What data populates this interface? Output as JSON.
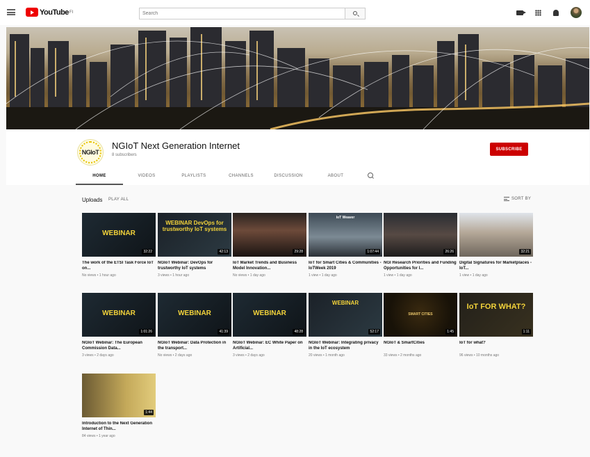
{
  "header": {
    "logo_text": "YouTube",
    "logo_region": "FI",
    "search_placeholder": "Search"
  },
  "channel": {
    "name": "NGIoT Next Generation Internet",
    "avatar_text": "NGIoT",
    "subscribers": "8 subscribers",
    "subscribe_label": "SUBSCRIBE"
  },
  "tabs": [
    "HOME",
    "VIDEOS",
    "PLAYLISTS",
    "CHANNELS",
    "DISCUSSION",
    "ABOUT"
  ],
  "section": {
    "title": "Uploads",
    "play_all": "PLAY ALL",
    "sort_by": "SORT BY"
  },
  "videos": [
    {
      "title": "The work of the ETSI Task Force IoT on...",
      "meta": "No views • 1 hour ago",
      "duration": "32:22",
      "thumb_text": "WEBINAR",
      "theme": "webinar"
    },
    {
      "title": "NGIoT Webinar: DevOps for trustworthy IoT systems",
      "meta": "3 views • 1 hour ago",
      "duration": "42:13",
      "thumb_text": "WEBINAR DevOps for trustworthy IoT systems",
      "theme": "webinar2"
    },
    {
      "title": "IoT Market Trends and Business Model Innovation...",
      "meta": "No views • 1 day ago",
      "duration": "29:28",
      "thumb_text": "",
      "theme": "conference"
    },
    {
      "title": "IoT for Smart Cities & Communities - IoTWeek 2019",
      "meta": "1 view • 1 day ago",
      "duration": "1:07:44",
      "thumb_text": "IoT Weaver",
      "theme": "panel"
    },
    {
      "title": "NGI Research Priorities and Funding Opportunities for I...",
      "meta": "1 view • 1 day ago",
      "duration": "26:26",
      "thumb_text": "",
      "theme": "audience"
    },
    {
      "title": "Digital Signatures for Marketplaces - IoT...",
      "meta": "1 view • 1 day ago",
      "duration": "32:21",
      "thumb_text": "",
      "theme": "office"
    },
    {
      "title": "NGIoT Webinar: The European Commission Data...",
      "meta": "3 views • 2 days ago",
      "duration": "1:01:26",
      "thumb_text": "WEBINAR",
      "theme": "webinar"
    },
    {
      "title": "NGIoT Webinar: Data Protection in the transport...",
      "meta": "No views • 2 days ago",
      "duration": "41:39",
      "thumb_text": "WEBINAR",
      "theme": "webinar"
    },
    {
      "title": "NGIoT Webinar: EC White Paper on Artificial...",
      "meta": "3 views • 2 days ago",
      "duration": "48:28",
      "thumb_text": "WEBINAR",
      "theme": "webinar"
    },
    {
      "title": "NGIoT Webinar: Integrating privacy in the IoT ecosystem",
      "meta": "20 views • 1 month ago",
      "duration": "52:17",
      "thumb_text": "WEBINAR",
      "theme": "webinar2"
    },
    {
      "title": "NGIoT & SmartCities",
      "meta": "33 views • 2 months ago",
      "duration": "1:45",
      "thumb_text": "SMART CITIES",
      "theme": "smart"
    },
    {
      "title": "IoT for what?",
      "meta": "96 views • 10 months ago",
      "duration": "1:11",
      "thumb_text": "IoT FOR WHAT?",
      "theme": "iotwhat"
    },
    {
      "title": "Introduction to the Next Generation Internet of Thin...",
      "meta": "84 views • 1 year ago",
      "duration": "1:44",
      "thumb_text": "",
      "theme": "speaker"
    }
  ]
}
